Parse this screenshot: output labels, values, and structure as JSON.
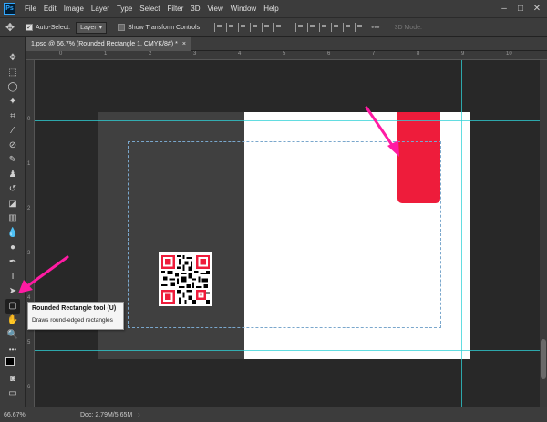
{
  "menubar": {
    "logo": "Ps",
    "items": [
      "File",
      "Edit",
      "Image",
      "Layer",
      "Type",
      "Select",
      "Filter",
      "3D",
      "View",
      "Window",
      "Help"
    ],
    "window_controls": [
      "–",
      "□",
      "✕"
    ]
  },
  "options_bar": {
    "move_icon": "move-icon",
    "auto_select_label": "Auto-Select:",
    "auto_select_checked": true,
    "layer_select": "Layer",
    "transform_label": "Show Transform Controls",
    "mode_3d_label": "3D Mode:"
  },
  "document_tab": {
    "title": "1.psd @ 66.7% (Rounded Rectangle 1, CMYK/8#) *",
    "close": "×"
  },
  "ruler": {
    "top_numbers": [
      "0",
      "1",
      "2",
      "3",
      "4",
      "5",
      "6",
      "7",
      "8",
      "9",
      "10"
    ],
    "left_numbers": [
      "0",
      "1",
      "2",
      "3",
      "4",
      "5",
      "6",
      "7"
    ]
  },
  "tooltip": {
    "title": "Rounded Rectangle tool (U)",
    "description": "Draws round-edged rectangles"
  },
  "status": {
    "zoom": "66.67%",
    "doc_info": "Doc: 2.79M/5.65M",
    "arrow_glyph": "›"
  },
  "colors": {
    "accent_red": "#ee1c3b",
    "annotation_arrow": "#ff1ba3",
    "guide_cyan": "#2fd2d7",
    "margin_dashed": "#7aa7cc"
  },
  "tools": [
    "move-tool",
    "marquee-tool",
    "lasso-tool",
    "magic-wand-tool",
    "crop-tool",
    "eyedropper-tool",
    "healing-brush-tool",
    "brush-tool",
    "clone-stamp-tool",
    "history-brush-tool",
    "eraser-tool",
    "gradient-tool",
    "blur-tool",
    "dodge-tool",
    "pen-tool",
    "type-tool",
    "path-selection-tool",
    "rounded-rectangle-tool",
    "hand-tool",
    "zoom-tool",
    "more-tools",
    "color-swatches",
    "quick-mask",
    "screen-mode"
  ]
}
